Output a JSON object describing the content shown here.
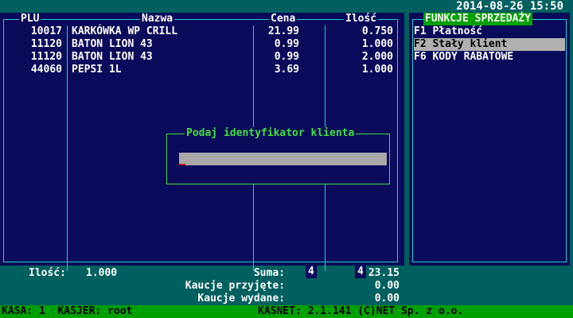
{
  "datetime": "2014-08-26 15:50",
  "table": {
    "headers": {
      "plu": "PLU",
      "name": "Nazwa",
      "price": "Cena",
      "qty": "Ilość"
    },
    "rows": [
      {
        "plu": "10017",
        "name": "KARKÓWKA WP CRILL",
        "price": "21.99",
        "qty": "0.750"
      },
      {
        "plu": "11120",
        "name": "BATON LION 43",
        "price": "0.99",
        "qty": "1.000"
      },
      {
        "plu": "11120",
        "name": "BATON LION 43",
        "price": "0.99",
        "qty": "2.000"
      },
      {
        "plu": "44060",
        "name": "PEPSI 1L",
        "price": "3.69",
        "qty": "1.000"
      }
    ],
    "count_price": "4",
    "count_qty": "4"
  },
  "functions": {
    "title": "FUNKCJE SPRZEDAŻY",
    "items": [
      {
        "label": "F1 Płatność",
        "selected": false
      },
      {
        "label": "F2 Stały klient",
        "selected": true
      },
      {
        "label": "F6 KODY RABATOWE",
        "selected": false
      }
    ]
  },
  "dialog": {
    "title": "Podaj identyfikator klienta",
    "value": ""
  },
  "summary": {
    "qty_label": "Ilość:",
    "qty_value": "1.000",
    "sum_label": "Suma:",
    "sum_value": "23.15",
    "deposit_in_label": "Kaucje przyjęte:",
    "deposit_in_value": "0.00",
    "deposit_out_label": "Kaucje wydane:",
    "deposit_out_value": "0.00"
  },
  "statusbar": {
    "left": "KASA: 1  KASJER: root",
    "right": "KASNET: 2.1.141 (C)NET Sp. z o.o."
  },
  "colors": {
    "background": "#005f5f",
    "panel": "#0a0a5a",
    "frame": "#20d0d0",
    "accent_green": "#00a000",
    "dialog_border": "#40e040",
    "cursor": "#d01010"
  }
}
